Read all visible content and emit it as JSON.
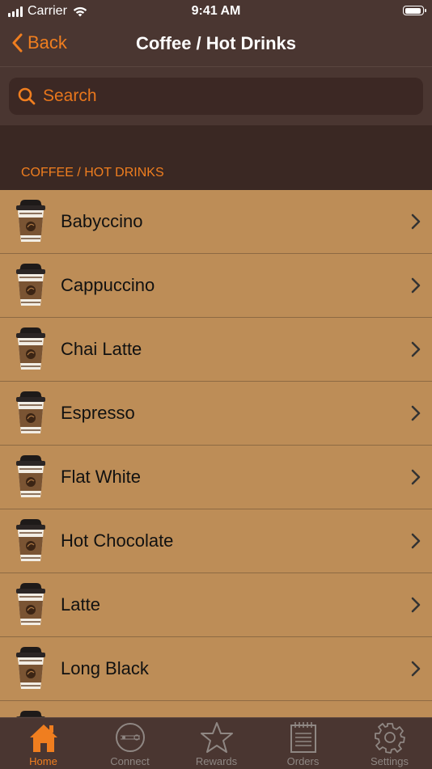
{
  "status_bar": {
    "carrier": "Carrier",
    "time": "9:41 AM"
  },
  "nav": {
    "back_label": "Back",
    "title": "Coffee / Hot Drinks"
  },
  "search": {
    "placeholder": "Search"
  },
  "section": {
    "title": "COFFEE / HOT DRINKS"
  },
  "items": [
    {
      "label": "Babyccino"
    },
    {
      "label": "Cappuccino"
    },
    {
      "label": "Chai Latte"
    },
    {
      "label": "Espresso"
    },
    {
      "label": "Flat White"
    },
    {
      "label": "Hot Chocolate"
    },
    {
      "label": "Latte"
    },
    {
      "label": "Long Black"
    },
    {
      "label": ""
    }
  ],
  "tabs": [
    {
      "label": "Home",
      "icon": "home-icon",
      "active": true
    },
    {
      "label": "Connect",
      "icon": "connect-icon",
      "active": false
    },
    {
      "label": "Rewards",
      "icon": "star-icon",
      "active": false
    },
    {
      "label": "Orders",
      "icon": "notepad-icon",
      "active": false
    },
    {
      "label": "Settings",
      "icon": "gear-icon",
      "active": false
    }
  ],
  "colors": {
    "accent": "#f07e1f",
    "nav_background": "#4a3631",
    "list_background": "#bd8d57",
    "section_background": "#3a2823"
  }
}
